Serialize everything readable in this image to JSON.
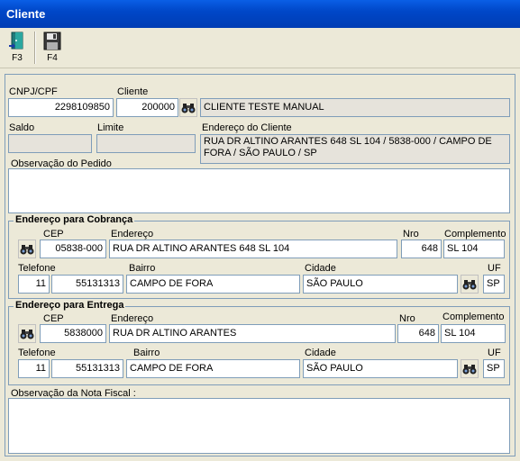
{
  "window": {
    "title": "Cliente"
  },
  "toolbar": {
    "exit_label": "F3",
    "save_label": "F4"
  },
  "cliente": {
    "cnpj_label": "CNPJ/CPF",
    "cnpj_value": "2298109850",
    "cliente_label": "Cliente",
    "cliente_code": "200000",
    "cliente_name": "CLIENTE TESTE MANUAL",
    "saldo_label": "Saldo",
    "saldo_value": "",
    "limite_label": "Limite",
    "limite_value": "",
    "endereco_label": "Endereço do Cliente",
    "endereco_value": "RUA DR ALTINO ARANTES 648 SL 104  /  5838-000  /  CAMPO DE FORA  /  SÃO PAULO  /  SP",
    "obs_label": "Observação do Pedido",
    "obs_value": ""
  },
  "cobranca": {
    "title": "Endereço para Cobrança",
    "cep_label": "CEP",
    "cep": "05838-000",
    "endereco_label": "Endereço",
    "endereco": "RUA DR ALTINO ARANTES 648 SL 104",
    "nro_label": "Nro",
    "nro": "648",
    "complemento_label": "Complemento",
    "complemento": "SL 104",
    "telefone_label": "Telefone",
    "ddd": "11",
    "telefone": "55131313",
    "bairro_label": "Bairro",
    "bairro": "CAMPO DE FORA",
    "cidade_label": "Cidade",
    "cidade": "SÃO PAULO",
    "uf_label": "UF",
    "uf": "SP"
  },
  "entrega": {
    "title": "Endereço para Entrega",
    "cep_label": "CEP",
    "cep": "5838000",
    "endereco_label": "Endereço",
    "endereco": "RUA DR ALTINO ARANTES",
    "nro_label": "Nro",
    "nro": "648",
    "complemento_label": "Complemento",
    "complemento": "SL 104",
    "telefone_label": "Telefone",
    "ddd": "11",
    "telefone": "55131313",
    "bairro_label": "Bairro",
    "bairro": "CAMPO DE FORA",
    "cidade_label": "Cidade",
    "cidade": "SÃO PAULO",
    "uf_label": "UF",
    "uf": "SP"
  },
  "nota_fiscal": {
    "obs_label": "Observação da Nota Fiscal :",
    "obs_value": ""
  }
}
